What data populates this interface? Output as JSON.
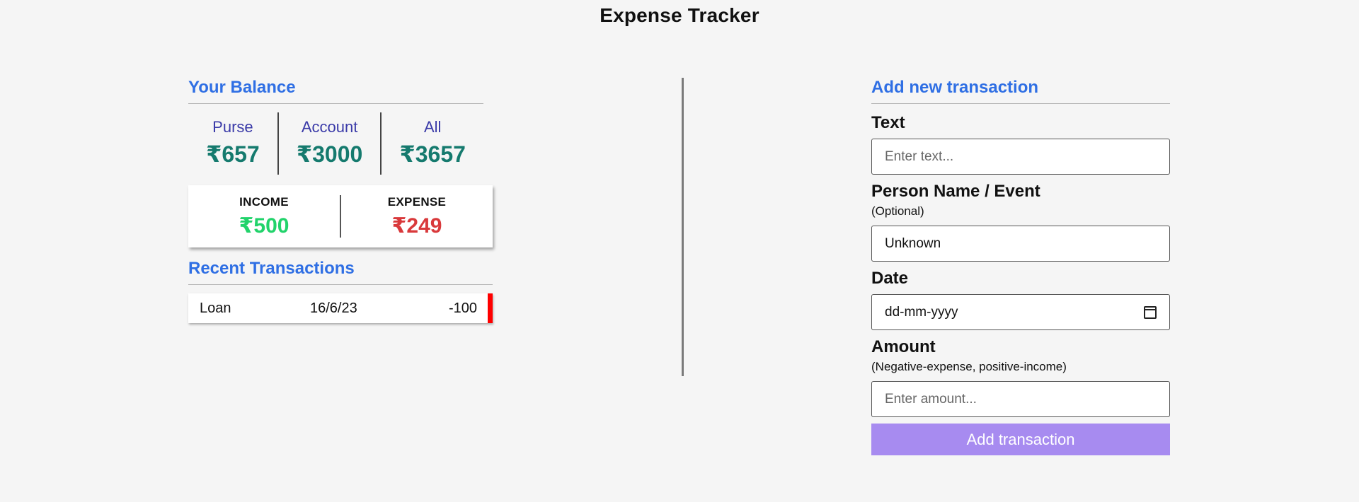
{
  "app": {
    "title": "Expense Tracker"
  },
  "balance": {
    "heading": "Your Balance",
    "purse": {
      "label": "Purse",
      "amount": "₹657"
    },
    "account": {
      "label": "Account",
      "amount": "₹3000"
    },
    "all": {
      "label": "All",
      "amount": "₹3657"
    }
  },
  "summary": {
    "income": {
      "label": "INCOME",
      "amount": "₹500"
    },
    "expense": {
      "label": "EXPENSE",
      "amount": "₹249"
    }
  },
  "recent": {
    "heading": "Recent Transactions",
    "items": [
      {
        "text": "Loan",
        "date": "16/6/23",
        "amount": "-100",
        "type_color": "#ff0000"
      }
    ]
  },
  "form": {
    "heading": "Add new transaction",
    "text_label": "Text",
    "text_placeholder": "Enter text...",
    "person_label": "Person Name / Event",
    "person_hint": "(Optional)",
    "person_value": "Unknown",
    "date_label": "Date",
    "date_placeholder": "dd-mm-yyyy",
    "amount_label": "Amount",
    "amount_hint": "(Negative-expense, positive-income)",
    "amount_placeholder": "Enter amount...",
    "submit_label": "Add transaction"
  },
  "colors": {
    "heading_blue": "#2f6fe4",
    "balance_label": "#3a3aa8",
    "balance_amount": "#157a6e",
    "income": "#22d36b",
    "expense": "#d9393b",
    "button": "#a78bf0"
  }
}
